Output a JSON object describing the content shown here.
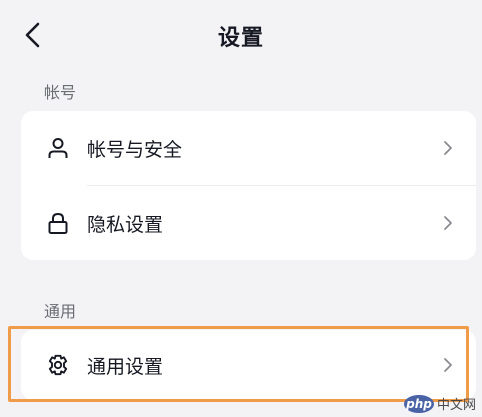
{
  "header": {
    "title": "设置",
    "back_icon": "chevron-left-icon"
  },
  "sections": [
    {
      "label": "帐号",
      "items": [
        {
          "label": "帐号与安全",
          "icon": "user-icon"
        },
        {
          "label": "隐私设置",
          "icon": "lock-icon"
        }
      ]
    },
    {
      "label": "通用",
      "items": [
        {
          "label": "通用设置",
          "icon": "gear-icon",
          "highlighted": true
        }
      ]
    }
  ],
  "watermark": {
    "logo_text": "php",
    "site_text": "中文网"
  },
  "colors": {
    "background": "#f3f3f5",
    "card": "#ffffff",
    "text": "#161823",
    "secondary_text": "#6b6d75",
    "highlight_border": "#f09b47"
  }
}
